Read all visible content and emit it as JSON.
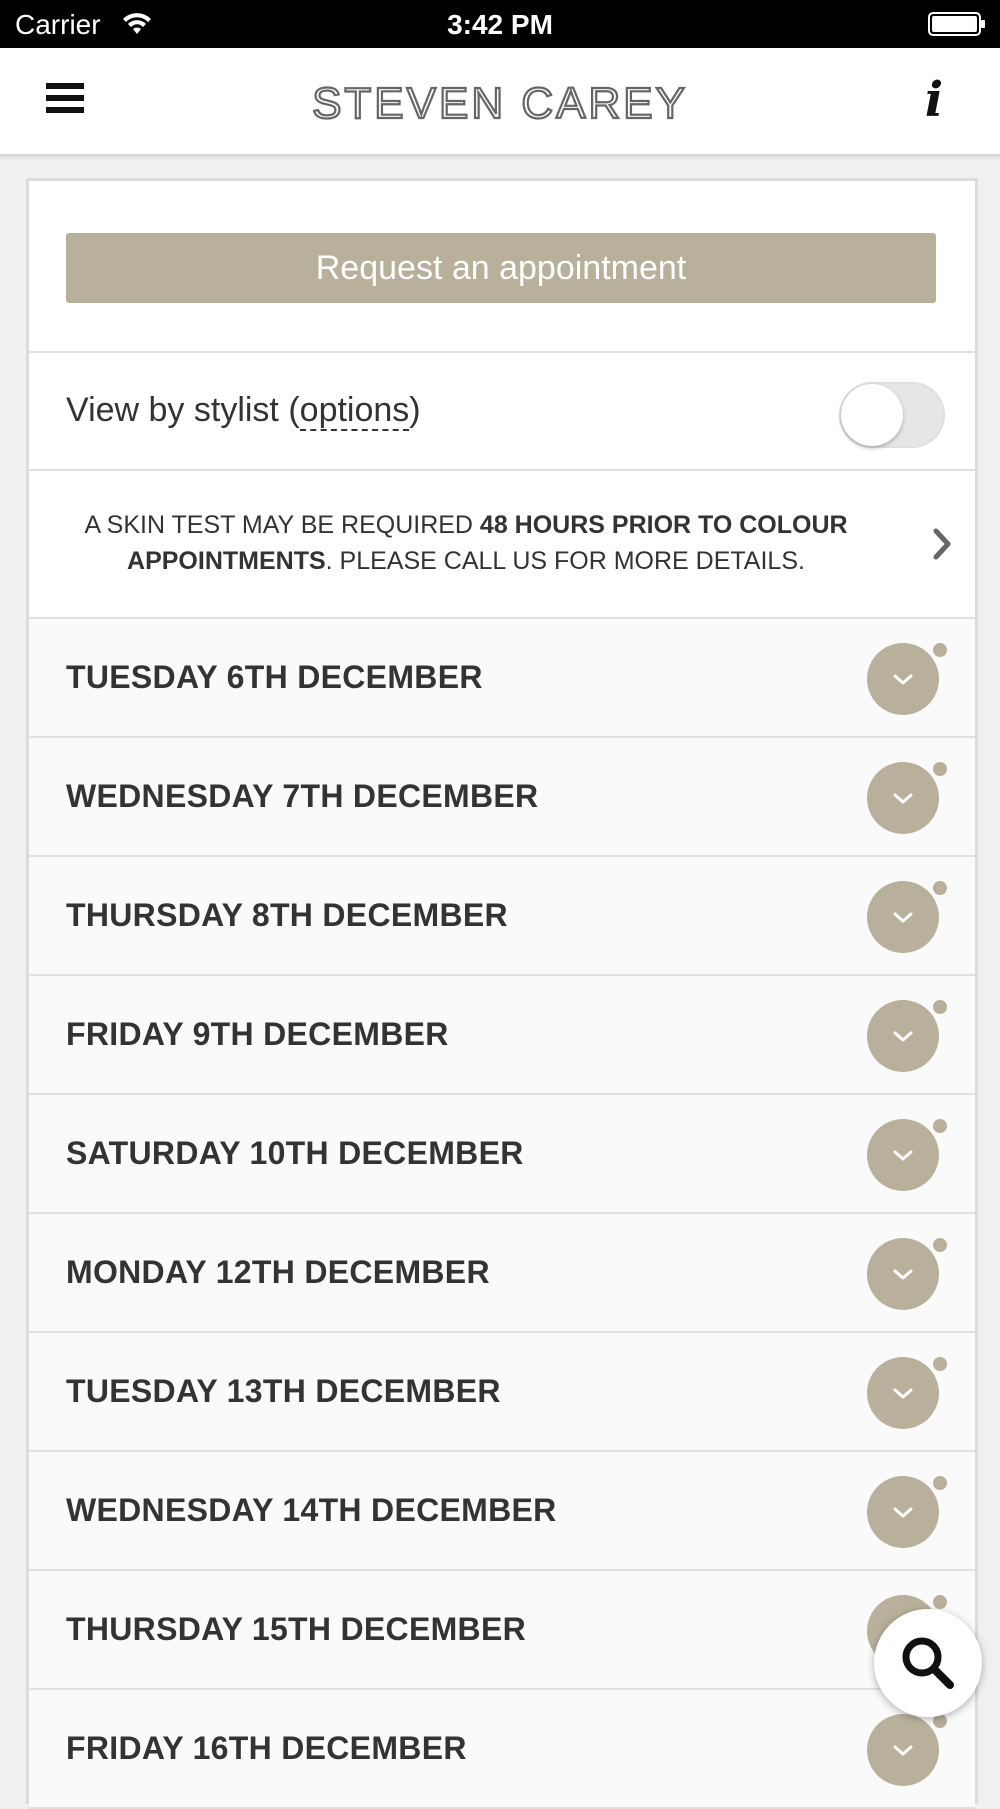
{
  "status_bar": {
    "carrier": "Carrier",
    "time": "3:42 PM"
  },
  "header": {
    "logo_text": "STEVEN CAREY",
    "menu_icon": "hamburger-icon",
    "info_icon": "info-icon",
    "info_glyph": "i"
  },
  "request_button_label": "Request an appointment",
  "stylist_filter": {
    "label_prefix": "View by stylist (",
    "label_link": "options",
    "label_suffix": ")",
    "enabled": false
  },
  "notice": {
    "text_part1": "A SKIN TEST MAY BE REQUIRED ",
    "text_bold1": "48 HOURS PRIOR TO COLOUR APPOINTMENTS",
    "text_part2": ". PLEASE CALL US FOR MORE DETAILS."
  },
  "days": [
    {
      "label": "TUESDAY 6TH DECEMBER"
    },
    {
      "label": "WEDNESDAY 7TH DECEMBER"
    },
    {
      "label": "THURSDAY 8TH DECEMBER"
    },
    {
      "label": "FRIDAY 9TH DECEMBER"
    },
    {
      "label": "SATURDAY 10TH DECEMBER"
    },
    {
      "label": "MONDAY 12TH DECEMBER"
    },
    {
      "label": "TUESDAY 13TH DECEMBER"
    },
    {
      "label": "WEDNESDAY 14TH DECEMBER"
    },
    {
      "label": "THURSDAY 15TH DECEMBER"
    },
    {
      "label": "FRIDAY 16TH DECEMBER"
    }
  ],
  "colors": {
    "accent": "#b8b09a",
    "text": "#333333",
    "background": "#f0f0f0"
  }
}
